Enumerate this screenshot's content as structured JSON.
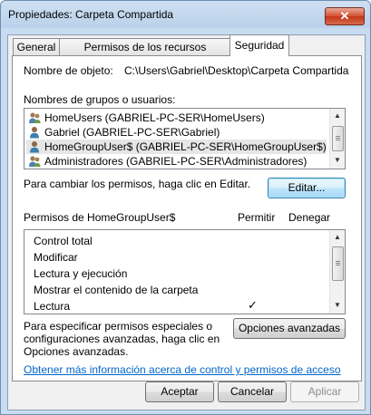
{
  "window": {
    "title": "Propiedades: Carpeta Compartida",
    "close_symbol": "✕"
  },
  "tabs": [
    {
      "label": "General"
    },
    {
      "label": "Permisos de los recursos compartidos"
    },
    {
      "label": "Seguridad",
      "active": true
    }
  ],
  "object": {
    "label": "Nombre de objeto:",
    "value": "C:\\Users\\Gabriel\\Desktop\\Carpeta Compartida"
  },
  "groups": {
    "label": "Nombres de grupos o usuarios:",
    "items": [
      {
        "name": "HomeUsers (GABRIEL-PC-SER\\HomeUsers)",
        "icon": "user-group-icon"
      },
      {
        "name": "Gabriel (GABRIEL-PC-SER\\Gabriel)",
        "icon": "user-icon"
      },
      {
        "name": "HomeGroupUser$ (GABRIEL-PC-SER\\HomeGroupUser$)",
        "icon": "user-icon",
        "selected": true
      },
      {
        "name": "Administradores (GABRIEL-PC-SER\\Administradores)",
        "icon": "user-group-icon"
      }
    ]
  },
  "change_text": "Para cambiar los permisos, haga clic en Editar.",
  "edit_button": "Editar...",
  "permissions": {
    "header": "Permisos de HomeGroupUser$",
    "allow_col": "Permitir",
    "deny_col": "Denegar",
    "items": [
      {
        "name": "Control total",
        "allow": false,
        "deny": false
      },
      {
        "name": "Modificar",
        "allow": false,
        "deny": false
      },
      {
        "name": "Lectura y ejecución",
        "allow": false,
        "deny": false
      },
      {
        "name": "Mostrar el contenido de la carpeta",
        "allow": false,
        "deny": false
      },
      {
        "name": "Lectura",
        "allow": true,
        "deny": false
      }
    ],
    "check_symbol": "✓"
  },
  "advanced": {
    "text_line1": "Para especificar permisos especiales o",
    "text_line2": "configuraciones avanzadas, haga clic en",
    "text_line3": "Opciones avanzadas.",
    "button": "Opciones avanzadas"
  },
  "help_link": "Obtener más información acerca de control y permisos de acceso",
  "footer": {
    "ok": "Aceptar",
    "cancel": "Cancelar",
    "apply": "Aplicar"
  }
}
